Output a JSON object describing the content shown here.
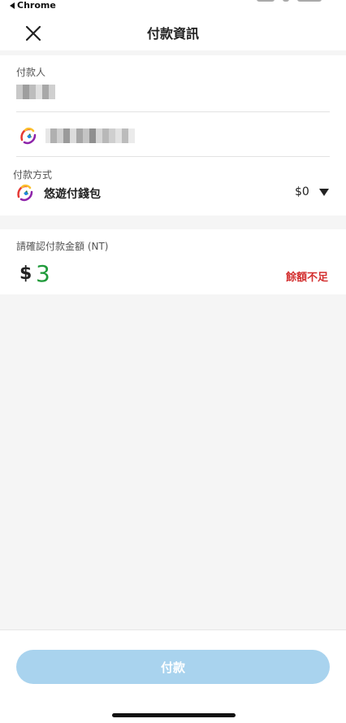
{
  "status_bar": {
    "back_app_label": "Chrome"
  },
  "header": {
    "title": "付款資訊",
    "close_icon": "close-icon"
  },
  "payer": {
    "label": "付款人",
    "name_masked": true,
    "account_icon": "app-logo-icon",
    "account_masked": true
  },
  "payment_method": {
    "label": "付款方式",
    "icon": "wallet-logo-icon",
    "name": "悠遊付錢包",
    "balance": "$0"
  },
  "amount_section": {
    "label": "請確認付款金額 (NT)",
    "currency_symbol": "$",
    "amount": "3",
    "warning": "餘額不足"
  },
  "footer": {
    "pay_button_label": "付款"
  },
  "colors": {
    "amount": "#1f9a3a",
    "warning": "#d32f2f",
    "pay_button_disabled": "#a9d3ee",
    "background": "#f5f5f5"
  }
}
